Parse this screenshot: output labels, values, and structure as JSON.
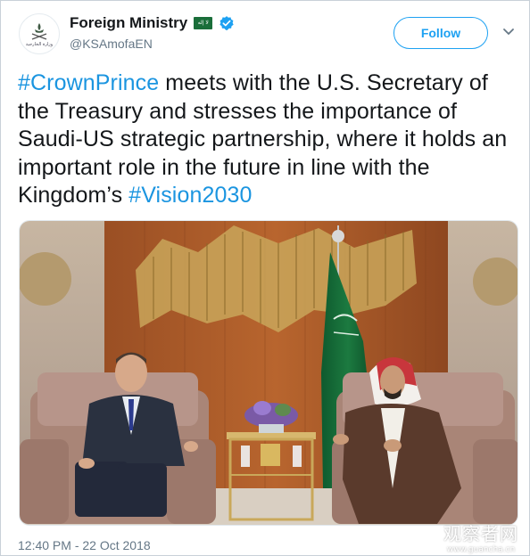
{
  "account": {
    "display_name": "Foreign Ministry",
    "handle": "@KSAmofaEN",
    "avatar_text": "وزارة الخارجية",
    "flag_text": "لا إله"
  },
  "header": {
    "follow_label": "Follow"
  },
  "tweet": {
    "hashtag_1": "#CrownPrince",
    "text_1": " meets with the U.S. Secretary of the Treasury and stresses the importance of Saudi-US strategic partnership, where it holds an important role in the future in line with the Kingdom’s ",
    "hashtag_2": "#Vision2030"
  },
  "meta": {
    "timestamp": "12:40 PM - 22 Oct 2018"
  },
  "watermark": {
    "main": "观察者网",
    "sub": "www.guancha.cn"
  },
  "colors": {
    "link": "#1b95e0",
    "follow_blue": "#1da1f2",
    "verified": "#1da1f2",
    "secondary_text": "#657786",
    "flag_green": "#1a6e3a"
  },
  "icons": {
    "verified": "verified-badge-icon",
    "caret": "chevron-down-icon",
    "flag": "saudi-flag-icon"
  }
}
